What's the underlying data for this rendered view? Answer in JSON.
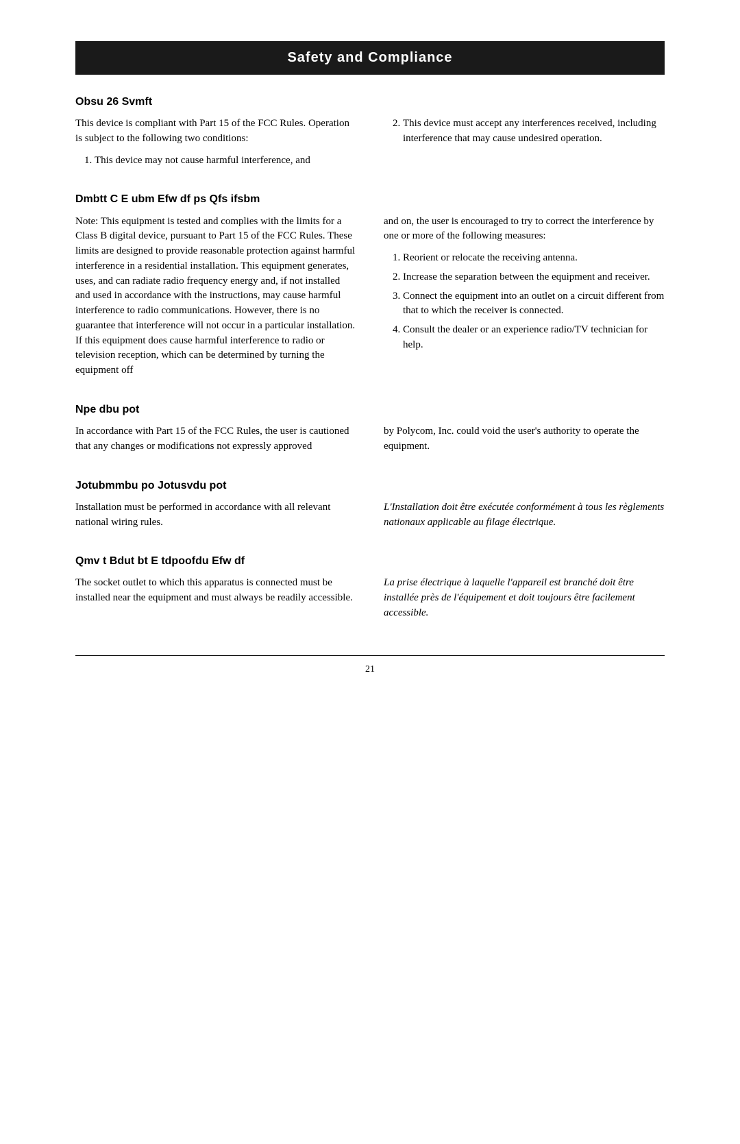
{
  "page": {
    "page_number": "21",
    "header": {
      "title": "Safety and Compliance"
    },
    "sections": [
      {
        "id": "fcc_part15",
        "title": "Obsu  26  Svmft",
        "left_paragraphs": [
          "This device is compliant with Part 15 of the FCC Rules.  Operation is subject to the following two conditions:"
        ],
        "left_list": [
          "This device may not cause harmful interference, and"
        ],
        "right_list": [
          "This device must accept any interferences received, including interference that may cause undesired operation."
        ]
      },
      {
        "id": "fcc_class_b",
        "title": "Dmbtt  C  E      ubm  Efw  df  ps  Qfs      ifsbm",
        "left_paragraphs": [
          "Note:  This equipment is tested and complies with the limits for a Class B digital device, pursuant to Part 15 of the FCC Rules.  These limits are designed to provide reasonable protection against harmful interference in a residential installation.  This equipment generates, uses, and can radiate radio frequency energy and, if not installed and used in accordance with the instructions, may cause harmful interference to radio communications.  However, there is no guarantee that interference will not occur in a particular installation.  If this equipment does cause harmful interference to radio or television reception, which can be determined by turning the equipment off"
        ],
        "right_paragraphs": [
          "and on, the user is encouraged to try to correct the interference by one or more of the following measures:"
        ],
        "right_list": [
          "Reorient or relocate the receiving antenna.",
          "Increase the separation between the equipment and receiver.",
          "Connect the equipment into an outlet on a circuit different from that to which the receiver is connected.",
          "Consult the dealer or an experience radio/TV technician for help."
        ]
      },
      {
        "id": "modifications",
        "title": "Npe      dbu  pot",
        "left_paragraphs": [
          "In accordance with Part 15 of the FCC Rules, the user is cautioned that any changes or modifications not expressly approved"
        ],
        "right_paragraphs": [
          "by Polycom, Inc. could void the user's authority to operate the equipment."
        ]
      },
      {
        "id": "installation",
        "title": "Jotubmmbu  po  Jotusvdu  pot",
        "left_paragraphs": [
          "Installation must be performed in accordance with all relevant national wiring rules."
        ],
        "right_paragraphs_italic": [
          "L'Installation doit être exécutée conformément à tous les règlements nationaux applicable au filage électrique."
        ]
      },
      {
        "id": "socket",
        "title": "Qmv  t  Bdut  bt  E  tdpoofdu  Efw  df",
        "left_paragraphs": [
          "The socket outlet to which this apparatus is connected must be installed near the equipment and must always be readily accessible."
        ],
        "right_paragraphs_italic": [
          "La prise électrique à laquelle l'appareil est branché doit être installée près de l'équipement et doit toujours être facilement accessible."
        ]
      }
    ]
  }
}
